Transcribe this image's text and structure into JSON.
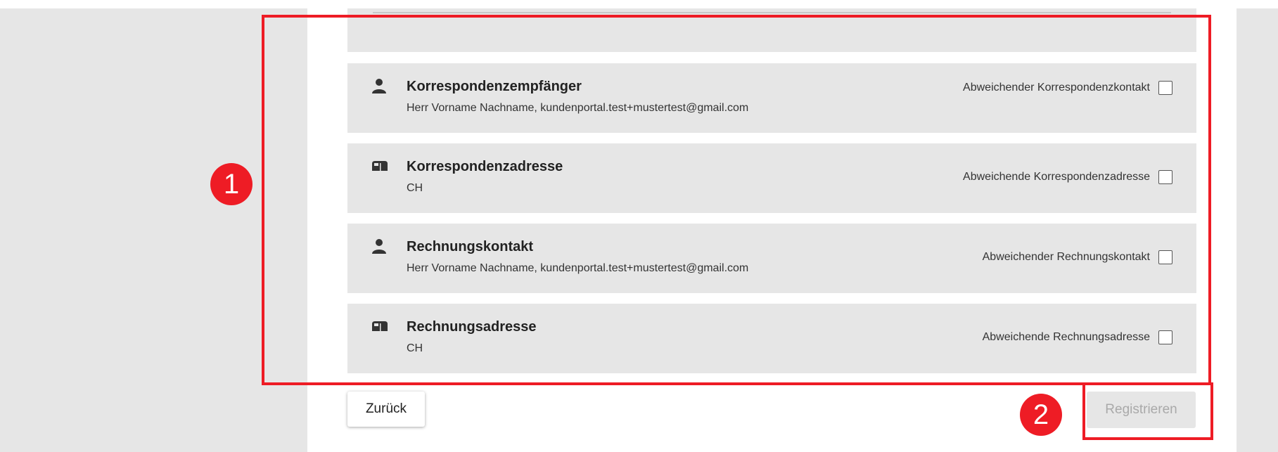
{
  "rows": [
    {
      "icon": "person-icon",
      "title": "Korrespondenzempfänger",
      "subtitle": "Herr Vorname Nachname, kundenportal.test+mustertest@gmail.com",
      "checkbox_label": "Abweichender Korrespondenzkontakt",
      "checked": false
    },
    {
      "icon": "mailbox-icon",
      "title": "Korrespondenzadresse",
      "subtitle": "CH",
      "checkbox_label": "Abweichende Korrespondenzadresse",
      "checked": false
    },
    {
      "icon": "person-icon",
      "title": "Rechnungskontakt",
      "subtitle": "Herr Vorname Nachname, kundenportal.test+mustertest@gmail.com",
      "checkbox_label": "Abweichender Rechnungskontakt",
      "checked": false
    },
    {
      "icon": "mailbox-icon",
      "title": "Rechnungsadresse",
      "subtitle": "CH",
      "checkbox_label": "Abweichende Rechnungsadresse",
      "checked": false
    }
  ],
  "buttons": {
    "back_label": "Zurück",
    "register_label": "Registrieren",
    "register_disabled": true
  },
  "annotations": {
    "marker_1": "1",
    "marker_2": "2",
    "highlight_color": "#ee1c25"
  },
  "colors": {
    "card_background": "#e6e6e6",
    "disabled_text": "#a9a9a9"
  }
}
